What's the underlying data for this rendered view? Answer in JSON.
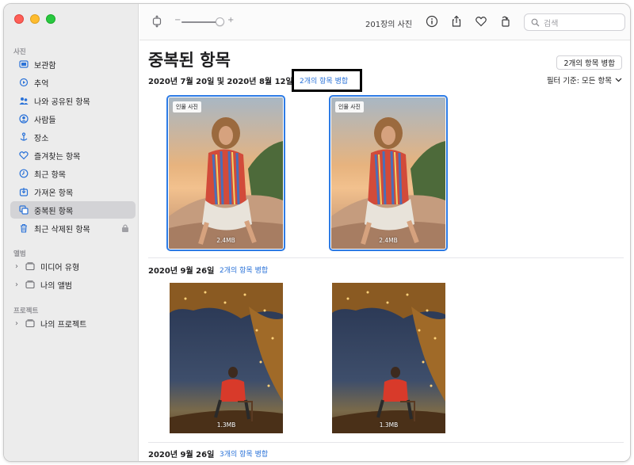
{
  "sidebar": {
    "section_photos": "사진",
    "items": [
      {
        "label": "보관함",
        "icon": "library-icon"
      },
      {
        "label": "추억",
        "icon": "memories-icon"
      },
      {
        "label": "나와 공유된 항목",
        "icon": "shared-with-you-icon"
      },
      {
        "label": "사람들",
        "icon": "people-icon"
      },
      {
        "label": "장소",
        "icon": "places-icon"
      },
      {
        "label": "즐겨찾는 항목",
        "icon": "heart-icon"
      },
      {
        "label": "최근 항목",
        "icon": "clock-icon"
      },
      {
        "label": "가져온 항목",
        "icon": "import-icon"
      },
      {
        "label": "중복된 항목",
        "icon": "duplicates-icon"
      },
      {
        "label": "최근 삭제된 항목",
        "icon": "trash-icon"
      }
    ],
    "section_albums": "앨범",
    "albums": [
      {
        "label": "미디어 유형"
      },
      {
        "label": "나의 앨범"
      }
    ],
    "section_projects": "프로젝트",
    "projects": [
      {
        "label": "나의 프로젝트"
      }
    ]
  },
  "toolbar": {
    "zoom_minus": "−",
    "zoom_plus": "+",
    "photo_count": "201장의 사진",
    "search_placeholder": "검색"
  },
  "main": {
    "title": "중복된 항목",
    "merge_all_label": "2개의 항목 병합",
    "filter_label": "필터 기준: 모든 항목",
    "groups": [
      {
        "date": "2020년 7월 20일 및 2020년 8월 12일",
        "merge_label": "2개의 항목 병합",
        "photos": [
          {
            "badge": "인물 사진",
            "size": "2.4MB"
          },
          {
            "badge": "인물 사진",
            "size": "2.4MB"
          }
        ]
      },
      {
        "date": "2020년 9월 26일",
        "merge_label": "2개의 항목 병합",
        "photos": [
          {
            "size": "1.3MB"
          },
          {
            "size": "1.3MB"
          }
        ]
      },
      {
        "date": "2020년 9월 26일",
        "merge_label": "3개의 항목 병합"
      }
    ]
  },
  "colors": {
    "accent": "#2a72d8",
    "selection": "#2d7be5",
    "sidebar_bg": "#ececec"
  }
}
